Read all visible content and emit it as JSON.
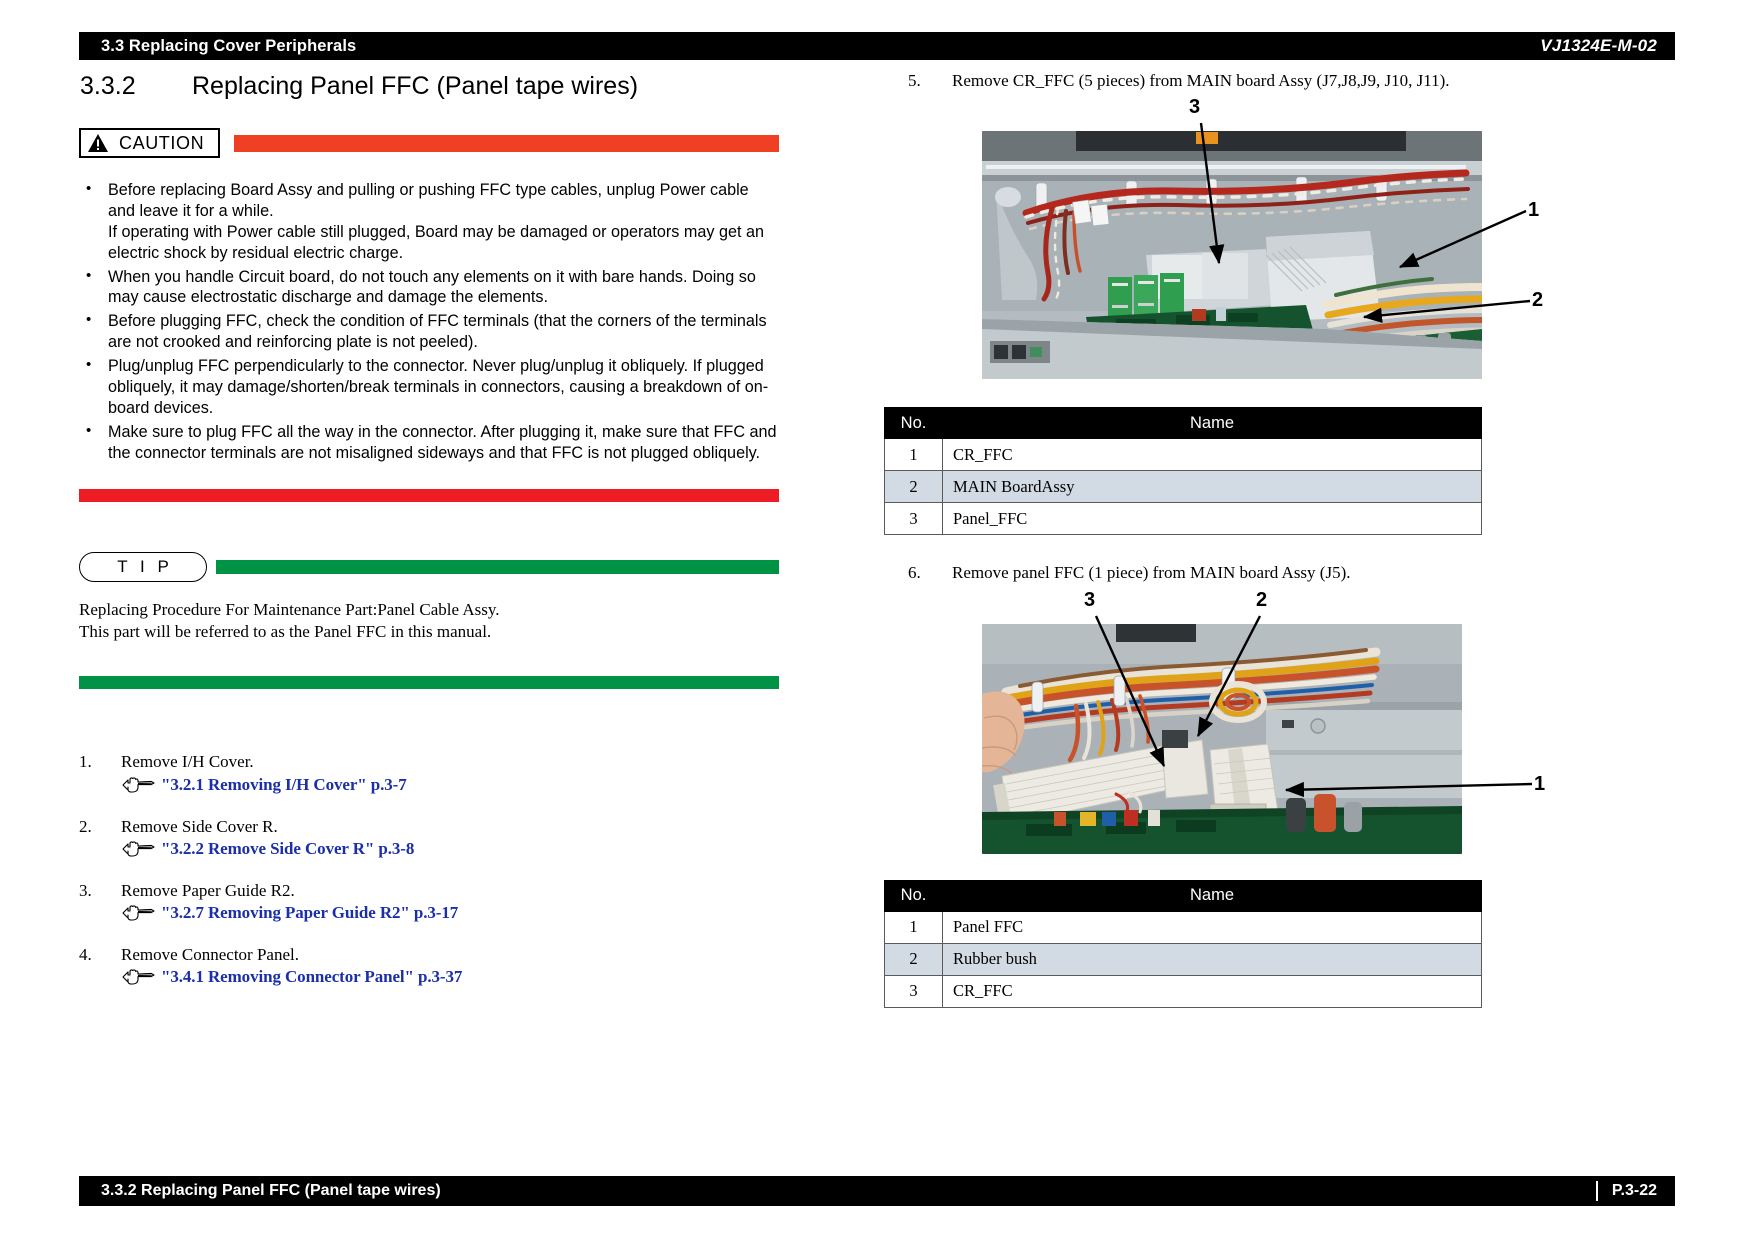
{
  "header": {
    "section_label": "3.3 Replacing Cover Peripherals",
    "doc_code": "VJ1324E-M-02"
  },
  "section": {
    "number": "3.3.2",
    "title": "Replacing Panel FFC (Panel tape wires)"
  },
  "caution": {
    "label": "CAUTION",
    "bullets": [
      "Before replacing Board Assy and pulling or pushing FFC type cables, unplug Power cable and leave it for a while.\nIf operating with Power cable still plugged, Board may be damaged or operators may get an electric shock by residual electric charge.",
      "When you handle Circuit board, do not touch any elements on it with bare hands. Doing so may cause electrostatic discharge and damage the elements.",
      "Before plugging FFC, check the condition of FFC terminals (that the corners of the terminals are not crooked and reinforcing plate is not peeled).",
      "Plug/unplug FFC perpendicularly to the connector.  Never plug/unplug it obliquely. If plugged obliquely, it may damage/shorten/break terminals in connectors, causing a breakdown of on-board devices.",
      "Make sure to plug FFC all the way in the connector. After plugging it, make sure that FFC and the connector terminals are not misaligned sideways and that FFC is not plugged obliquely."
    ],
    "bar_color": "#ef4023",
    "foot_bar_color": "#ee1c25"
  },
  "tip": {
    "label": "T I P",
    "line1": "Replacing Procedure For Maintenance Part:Panel Cable Assy.",
    "line2": "This part will be referred to as the Panel FFC in this manual.",
    "bar_color": "#009245"
  },
  "steps_left": [
    {
      "num": "1.",
      "text": "Remove I/H  Cover.",
      "link": "\"3.2.1 Removing I/H Cover\" p.3-7"
    },
    {
      "num": "2.",
      "text": "Remove Side Cover R.",
      "link": "\"3.2.2 Remove Side Cover R\" p.3-8"
    },
    {
      "num": "3.",
      "text": " Remove Paper Guide  R2.",
      "link": "\"3.2.7 Removing Paper Guide R2\" p.3-17"
    },
    {
      "num": "4.",
      "text": "Remove Connector Panel.",
      "link": "\"3.4.1 Removing Connector Panel\" p.3-37"
    }
  ],
  "steps_right": [
    {
      "num": "5.",
      "text": "Remove CR_FFC (5 pieces) from MAIN board  Assy  (J7,J8,J9, J10, J11)."
    },
    {
      "num": "6.",
      "text": "Remove panel FFC (1 piece) from MAIN board Assy (J5)."
    }
  ],
  "figure1": {
    "callouts": [
      "3",
      "1",
      "2"
    ]
  },
  "figure2": {
    "callouts": [
      "3",
      "2",
      "1"
    ]
  },
  "table1": {
    "headers": [
      "No.",
      "Name"
    ],
    "rows": [
      {
        "no": "1",
        "name": "CR_FFC"
      },
      {
        "no": "2",
        "name": "MAIN BoardAssy"
      },
      {
        "no": "3",
        "name": "Panel_FFC"
      }
    ]
  },
  "table2": {
    "headers": [
      "No.",
      "Name"
    ],
    "rows": [
      {
        "no": "1",
        "name": "Panel FFC"
      },
      {
        "no": "2",
        "name": "Rubber bush"
      },
      {
        "no": "3",
        "name": "CR_FFC"
      }
    ]
  },
  "footer": {
    "left": "3.3.2 Replacing Panel FFC (Panel tape wires)",
    "page": "P.3-22"
  }
}
